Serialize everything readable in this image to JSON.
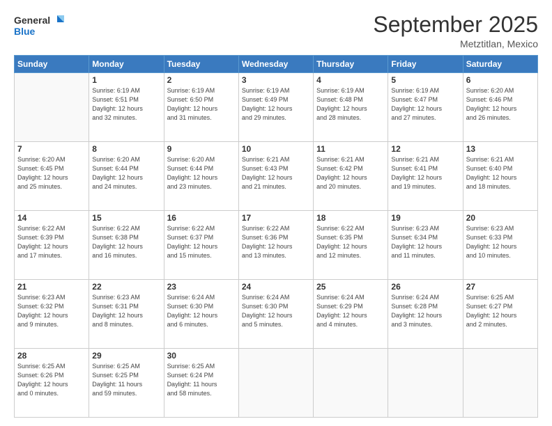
{
  "header": {
    "logo_line1": "General",
    "logo_line2": "Blue",
    "month_title": "September 2025",
    "subtitle": "Metztitlan, Mexico"
  },
  "weekdays": [
    "Sunday",
    "Monday",
    "Tuesday",
    "Wednesday",
    "Thursday",
    "Friday",
    "Saturday"
  ],
  "weeks": [
    [
      {
        "day": "",
        "info": ""
      },
      {
        "day": "1",
        "info": "Sunrise: 6:19 AM\nSunset: 6:51 PM\nDaylight: 12 hours\nand 32 minutes."
      },
      {
        "day": "2",
        "info": "Sunrise: 6:19 AM\nSunset: 6:50 PM\nDaylight: 12 hours\nand 31 minutes."
      },
      {
        "day": "3",
        "info": "Sunrise: 6:19 AM\nSunset: 6:49 PM\nDaylight: 12 hours\nand 29 minutes."
      },
      {
        "day": "4",
        "info": "Sunrise: 6:19 AM\nSunset: 6:48 PM\nDaylight: 12 hours\nand 28 minutes."
      },
      {
        "day": "5",
        "info": "Sunrise: 6:19 AM\nSunset: 6:47 PM\nDaylight: 12 hours\nand 27 minutes."
      },
      {
        "day": "6",
        "info": "Sunrise: 6:20 AM\nSunset: 6:46 PM\nDaylight: 12 hours\nand 26 minutes."
      }
    ],
    [
      {
        "day": "7",
        "info": "Sunrise: 6:20 AM\nSunset: 6:45 PM\nDaylight: 12 hours\nand 25 minutes."
      },
      {
        "day": "8",
        "info": "Sunrise: 6:20 AM\nSunset: 6:44 PM\nDaylight: 12 hours\nand 24 minutes."
      },
      {
        "day": "9",
        "info": "Sunrise: 6:20 AM\nSunset: 6:44 PM\nDaylight: 12 hours\nand 23 minutes."
      },
      {
        "day": "10",
        "info": "Sunrise: 6:21 AM\nSunset: 6:43 PM\nDaylight: 12 hours\nand 21 minutes."
      },
      {
        "day": "11",
        "info": "Sunrise: 6:21 AM\nSunset: 6:42 PM\nDaylight: 12 hours\nand 20 minutes."
      },
      {
        "day": "12",
        "info": "Sunrise: 6:21 AM\nSunset: 6:41 PM\nDaylight: 12 hours\nand 19 minutes."
      },
      {
        "day": "13",
        "info": "Sunrise: 6:21 AM\nSunset: 6:40 PM\nDaylight: 12 hours\nand 18 minutes."
      }
    ],
    [
      {
        "day": "14",
        "info": "Sunrise: 6:22 AM\nSunset: 6:39 PM\nDaylight: 12 hours\nand 17 minutes."
      },
      {
        "day": "15",
        "info": "Sunrise: 6:22 AM\nSunset: 6:38 PM\nDaylight: 12 hours\nand 16 minutes."
      },
      {
        "day": "16",
        "info": "Sunrise: 6:22 AM\nSunset: 6:37 PM\nDaylight: 12 hours\nand 15 minutes."
      },
      {
        "day": "17",
        "info": "Sunrise: 6:22 AM\nSunset: 6:36 PM\nDaylight: 12 hours\nand 13 minutes."
      },
      {
        "day": "18",
        "info": "Sunrise: 6:22 AM\nSunset: 6:35 PM\nDaylight: 12 hours\nand 12 minutes."
      },
      {
        "day": "19",
        "info": "Sunrise: 6:23 AM\nSunset: 6:34 PM\nDaylight: 12 hours\nand 11 minutes."
      },
      {
        "day": "20",
        "info": "Sunrise: 6:23 AM\nSunset: 6:33 PM\nDaylight: 12 hours\nand 10 minutes."
      }
    ],
    [
      {
        "day": "21",
        "info": "Sunrise: 6:23 AM\nSunset: 6:32 PM\nDaylight: 12 hours\nand 9 minutes."
      },
      {
        "day": "22",
        "info": "Sunrise: 6:23 AM\nSunset: 6:31 PM\nDaylight: 12 hours\nand 8 minutes."
      },
      {
        "day": "23",
        "info": "Sunrise: 6:24 AM\nSunset: 6:30 PM\nDaylight: 12 hours\nand 6 minutes."
      },
      {
        "day": "24",
        "info": "Sunrise: 6:24 AM\nSunset: 6:30 PM\nDaylight: 12 hours\nand 5 minutes."
      },
      {
        "day": "25",
        "info": "Sunrise: 6:24 AM\nSunset: 6:29 PM\nDaylight: 12 hours\nand 4 minutes."
      },
      {
        "day": "26",
        "info": "Sunrise: 6:24 AM\nSunset: 6:28 PM\nDaylight: 12 hours\nand 3 minutes."
      },
      {
        "day": "27",
        "info": "Sunrise: 6:25 AM\nSunset: 6:27 PM\nDaylight: 12 hours\nand 2 minutes."
      }
    ],
    [
      {
        "day": "28",
        "info": "Sunrise: 6:25 AM\nSunset: 6:26 PM\nDaylight: 12 hours\nand 0 minutes."
      },
      {
        "day": "29",
        "info": "Sunrise: 6:25 AM\nSunset: 6:25 PM\nDaylight: 11 hours\nand 59 minutes."
      },
      {
        "day": "30",
        "info": "Sunrise: 6:25 AM\nSunset: 6:24 PM\nDaylight: 11 hours\nand 58 minutes."
      },
      {
        "day": "",
        "info": ""
      },
      {
        "day": "",
        "info": ""
      },
      {
        "day": "",
        "info": ""
      },
      {
        "day": "",
        "info": ""
      }
    ]
  ]
}
